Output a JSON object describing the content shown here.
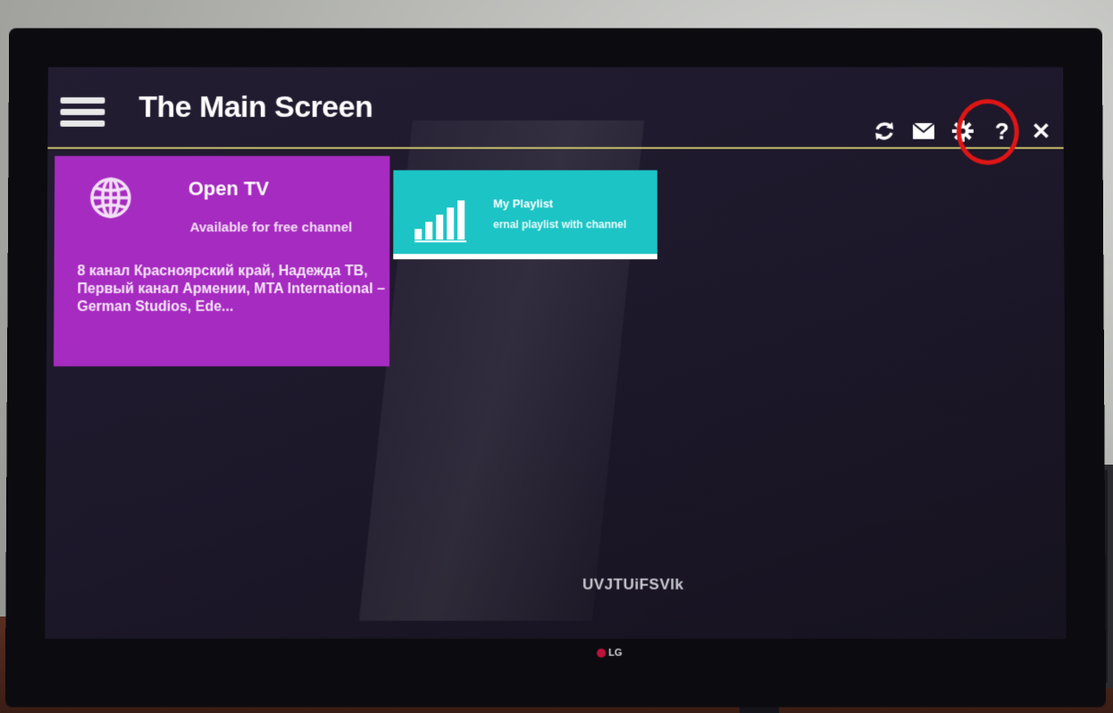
{
  "header": {
    "title": "The Main Screen",
    "toolbar": {
      "refresh_icon": "refresh-icon",
      "mail_icon": "mail-icon",
      "settings_icon": "gear-icon",
      "help_glyph": "?",
      "close_glyph": "✕"
    },
    "highlight_color": "#e01515"
  },
  "tiles": [
    {
      "title": "Open TV",
      "subtitle": "Available for free channel",
      "description": "8 канал Красноярский край, Надежда ТВ, Первый канал Армении, MTA International – German Studios, Ede...",
      "color": "#a62bc0",
      "icon": "globe-icon"
    },
    {
      "title": "My Playlist",
      "subtitle": "ernal playlist with channel",
      "color": "#1cc4c6",
      "icon": "signal-bars-icon"
    }
  ],
  "footer": {
    "code": "UVJTUiFSVlk",
    "brand": "LG"
  }
}
